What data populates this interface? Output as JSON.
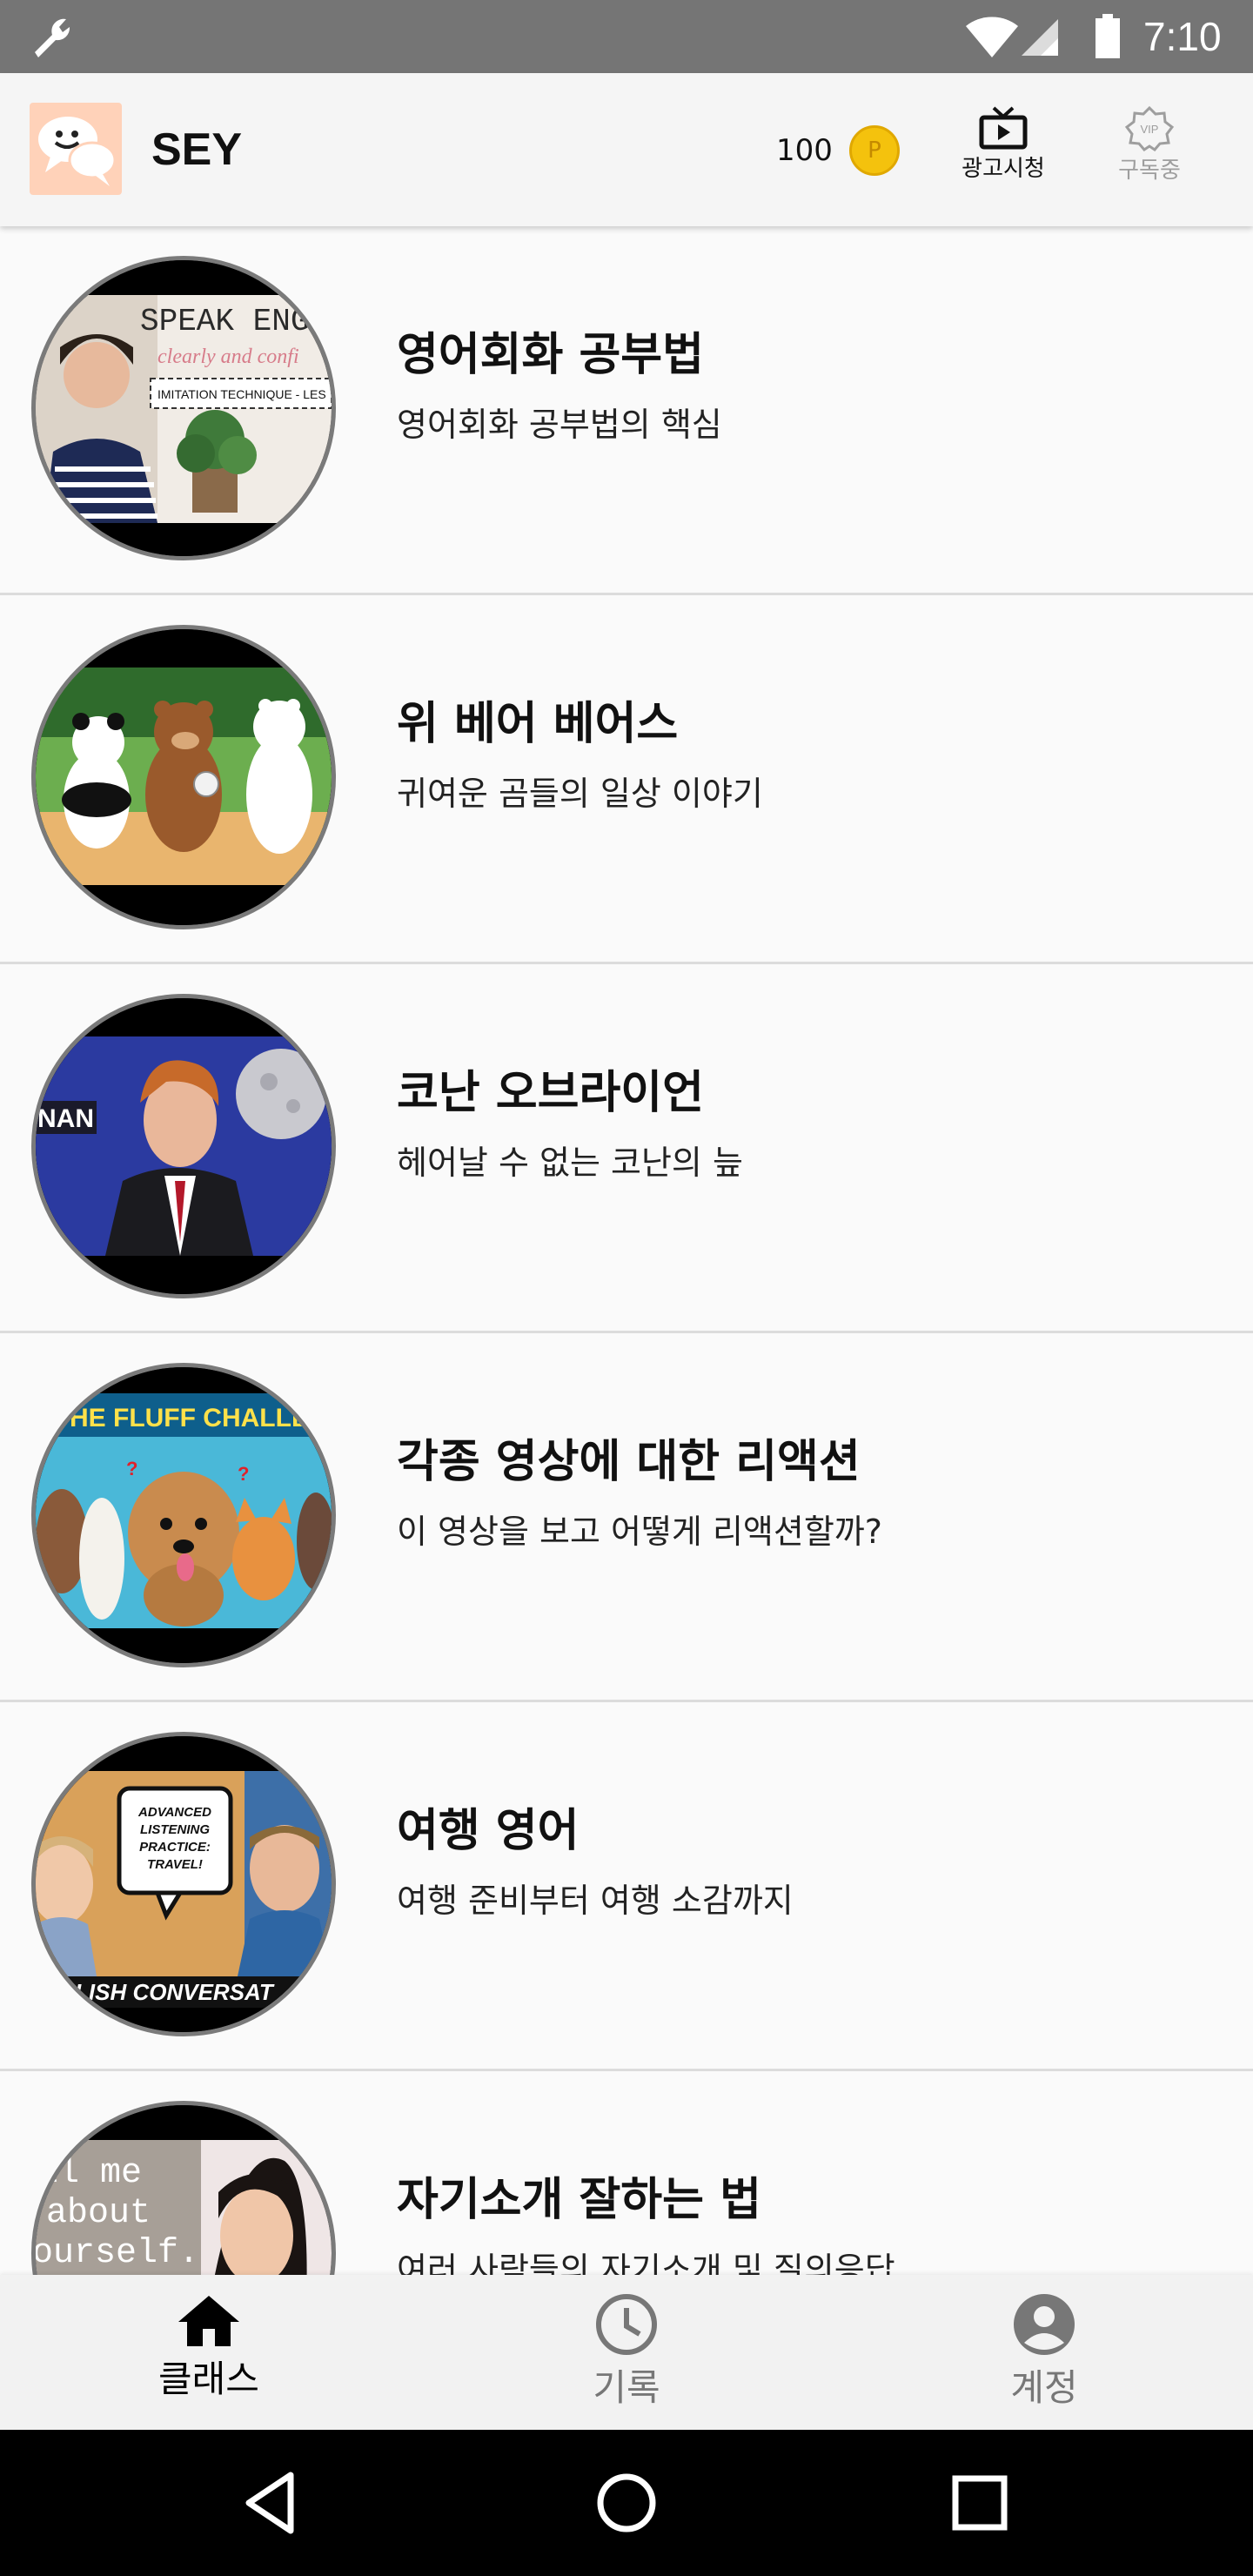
{
  "status_bar": {
    "time": "7:10",
    "icons": [
      "wrench-icon",
      "wifi-icon",
      "signal-icon",
      "battery-icon"
    ],
    "background": "#757575"
  },
  "app_bar": {
    "title": "SEY",
    "points": "100",
    "coin_label": "P",
    "actions": [
      {
        "label": "광고시청",
        "icon": "tv-play-icon"
      },
      {
        "label": "구독중",
        "icon": "vip-badge-icon",
        "badge": "VIP"
      }
    ]
  },
  "classes": [
    {
      "title": "영어회화 공부법",
      "subtitle": "영어회화 공부법의 핵심",
      "thumb_text": [
        "SPEAK ENGL",
        "clearly and confi",
        "IMITATION TECHNIQUE - LES"
      ]
    },
    {
      "title": "위 베어 베어스",
      "subtitle": "귀여운 곰들의 일상 이야기"
    },
    {
      "title": "코난 오브라이언",
      "subtitle": "헤어날 수 없는 코난의 늪",
      "thumb_text": [
        "NAN"
      ]
    },
    {
      "title": "각종 영상에 대한 리액션",
      "subtitle": "이 영상을 보고 어떻게 리액션할까?",
      "thumb_text": [
        "T THE FLUFF CHALLE"
      ]
    },
    {
      "title": "여행 영어",
      "subtitle": "여행 준비부터 여행 소감까지",
      "thumb_text": [
        "ADVANCED",
        "LISTENING",
        "PRACTICE:",
        "TRAVEL!",
        "NGLISH CONVERSAT"
      ]
    },
    {
      "title": "자기소개 잘하는 법",
      "subtitle": "여러 사람들의 자기소개 및 질의응답",
      "thumb_text": [
        "ll me",
        "about",
        "ourself."
      ]
    }
  ],
  "bottom_nav": [
    {
      "label": "클래스",
      "icon": "home-icon",
      "active": true
    },
    {
      "label": "기록",
      "icon": "clock-icon",
      "active": false
    },
    {
      "label": "계정",
      "icon": "account-circle-icon",
      "active": false
    }
  ],
  "system_nav": [
    "back-icon",
    "home-circle-icon",
    "recents-icon"
  ],
  "colors": {
    "accent_coin": "#f4c20d",
    "active_nav": "#000000",
    "inactive_nav": "#777777"
  }
}
